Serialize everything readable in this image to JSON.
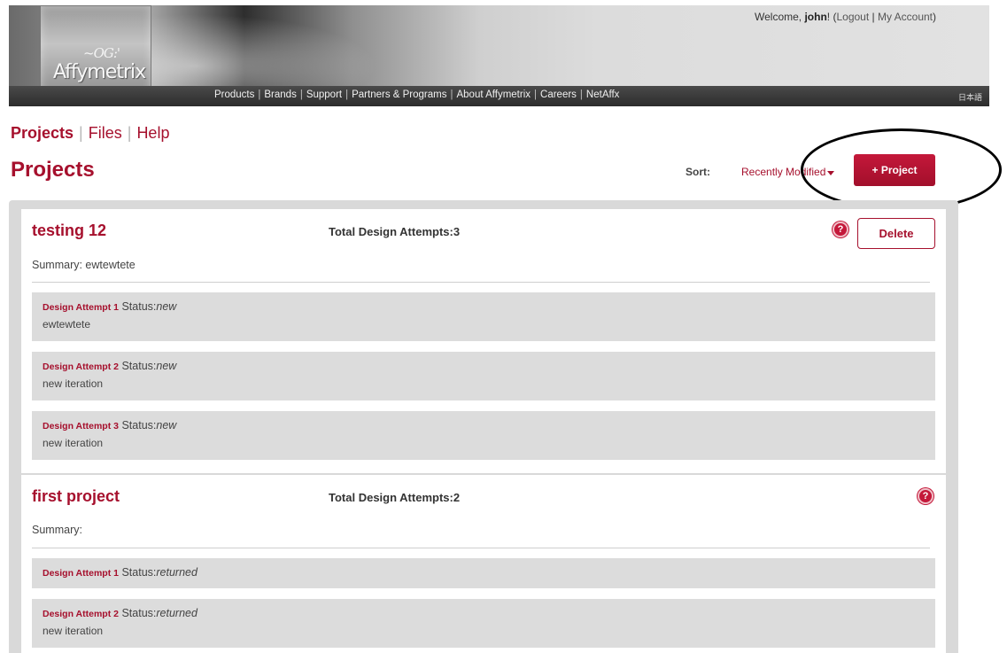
{
  "header": {
    "logo_text": "Affymetrix",
    "logo_mark": "~OG:'",
    "welcome_prefix": "Welcome, ",
    "welcome_user": "john",
    "welcome_suffix": "! (",
    "logout": "Logout",
    "my_account": "My Account",
    "close_paren": ")",
    "nav": [
      "Products",
      "Brands",
      "Support",
      "Partners & Programs",
      "About Affymetrix",
      "Careers",
      "NetAffx"
    ],
    "language": "日本語"
  },
  "subnav": {
    "items": [
      "Projects",
      "Files",
      "Help"
    ],
    "active": "Projects"
  },
  "page_title": "Projects",
  "sort": {
    "label": "Sort:",
    "value": "Recently Modified"
  },
  "add_project_label": "+ Project",
  "projects": [
    {
      "name": "testing 12",
      "total_attempts_label": "Total Design Attempts:3",
      "summary": "Summary: ewtewtete",
      "delete_label": "Delete",
      "help_glyph": "?",
      "attempts": [
        {
          "name": "Design Attempt 1",
          "status_label": "Status:",
          "status": "new",
          "description": "ewtewtete"
        },
        {
          "name": "Design Attempt 2",
          "status_label": "Status:",
          "status": "new",
          "description": "new iteration"
        },
        {
          "name": "Design Attempt 3",
          "status_label": "Status:",
          "status": "new",
          "description": "new iteration"
        }
      ]
    },
    {
      "name": "first project",
      "total_attempts_label": "Total Design Attempts:2",
      "summary": "Summary:",
      "help_glyph": "?",
      "attempts": [
        {
          "name": "Design Attempt 1",
          "status_label": "Status:",
          "status": "returned",
          "description": ""
        },
        {
          "name": "Design Attempt 2",
          "status_label": "Status:",
          "status": "returned",
          "description": "new iteration"
        }
      ]
    }
  ],
  "colors": {
    "brand": "#a6102d",
    "panel_bg": "#d9d9d9",
    "attempt_bg": "#dcdcdc"
  }
}
